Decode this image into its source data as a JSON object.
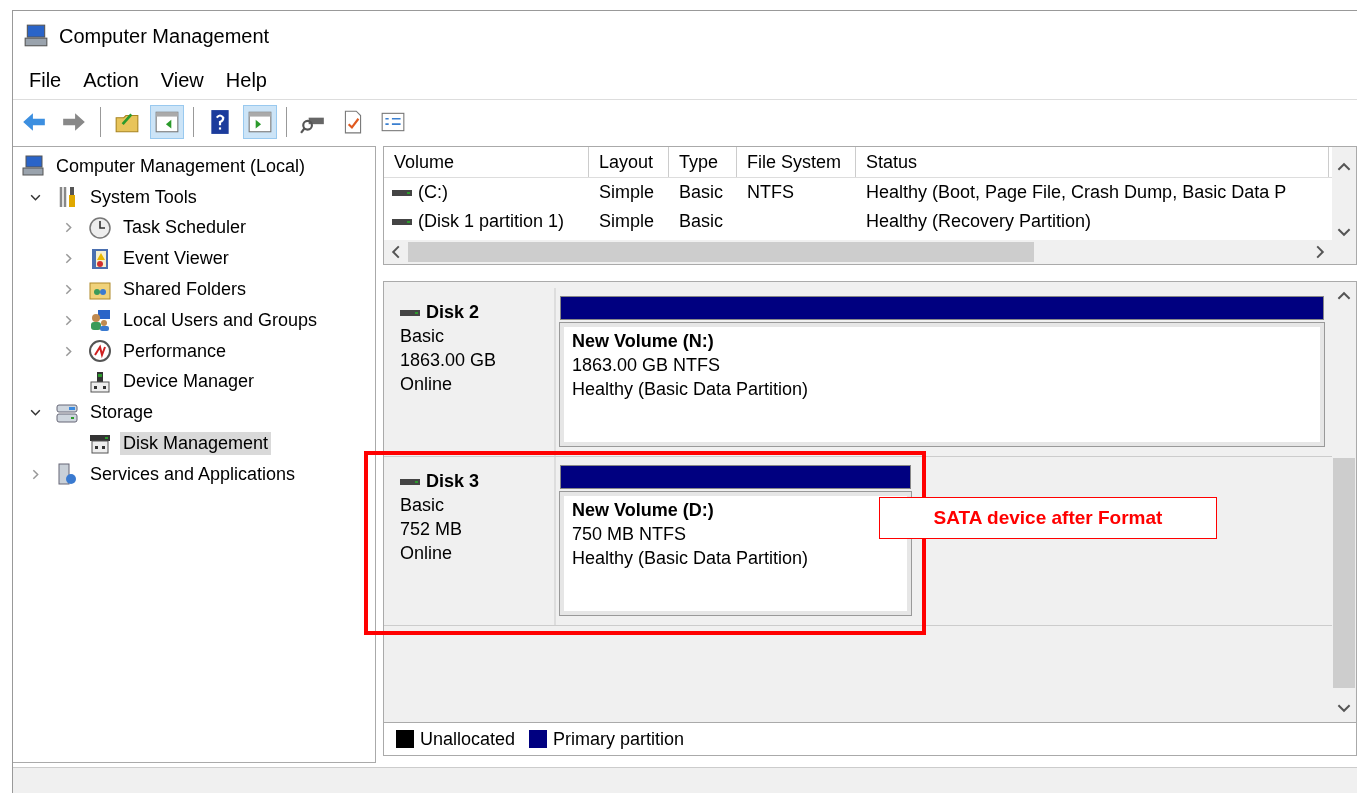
{
  "window": {
    "title": "Computer Management"
  },
  "menu": [
    {
      "label": "File"
    },
    {
      "label": "Action"
    },
    {
      "label": "View"
    },
    {
      "label": "Help"
    }
  ],
  "toolbar": [
    {
      "selected": false
    },
    {
      "selected": false
    },
    {
      "selected": false
    },
    {
      "selected": true
    },
    {
      "selected": false
    },
    {
      "selected": true
    },
    {
      "selected": false
    },
    {
      "selected": false
    },
    {
      "selected": false
    }
  ],
  "tree": [
    {
      "label": "Computer Management (Local)",
      "selected": false,
      "children": [
        {
          "label": "System Tools",
          "selected": false,
          "expanded": true,
          "children": [
            {
              "label": "Task Scheduler",
              "selected": false,
              "expanded": false
            },
            {
              "label": "Event Viewer",
              "selected": false,
              "expanded": false
            },
            {
              "label": "Shared Folders",
              "selected": false,
              "expanded": false
            },
            {
              "label": "Local Users and Groups",
              "selected": false,
              "expanded": false
            },
            {
              "label": "Performance",
              "selected": false,
              "expanded": false
            },
            {
              "label": "Device Manager",
              "selected": false
            }
          ]
        },
        {
          "label": "Storage",
          "selected": false,
          "expanded": true,
          "children": [
            {
              "label": "Disk Management",
              "selected": true
            }
          ]
        },
        {
          "label": "Services and Applications",
          "selected": false,
          "expanded": false
        }
      ]
    }
  ],
  "volume_table": {
    "columns": [
      "Volume",
      "Layout",
      "Type",
      "File System",
      "Status"
    ],
    "rows": [
      {
        "cells": [
          "(C:)",
          "Simple",
          "Basic",
          "NTFS",
          "Healthy (Boot, Page File, Crash Dump, Basic Data P"
        ]
      },
      {
        "cells": [
          "(Disk 1 partition 1)",
          "Simple",
          "Basic",
          "",
          "Healthy (Recovery Partition)"
        ]
      }
    ]
  },
  "disks": [
    {
      "name": "Disk 2",
      "type": "Basic",
      "size": "1863.00 GB",
      "status": "Online",
      "highlighted": false,
      "partitions": [
        {
          "name": "New Volume  (N:)",
          "size": "1863.00 GB NTFS",
          "status": "Healthy (Basic Data Partition)"
        }
      ]
    },
    {
      "name": "Disk 3",
      "type": "Basic",
      "size": "752 MB",
      "status": "Online",
      "highlighted": true,
      "partitions": [
        {
          "name": "New Volume  (D:)",
          "size": "750 MB NTFS",
          "status": "Healthy (Basic Data Partition)"
        }
      ]
    }
  ],
  "annotation": {
    "label": "SATA device after Format"
  },
  "legend": [
    {
      "label": "Unallocated",
      "color": "#000000"
    },
    {
      "label": "Primary partition",
      "color": "#000080"
    }
  ]
}
